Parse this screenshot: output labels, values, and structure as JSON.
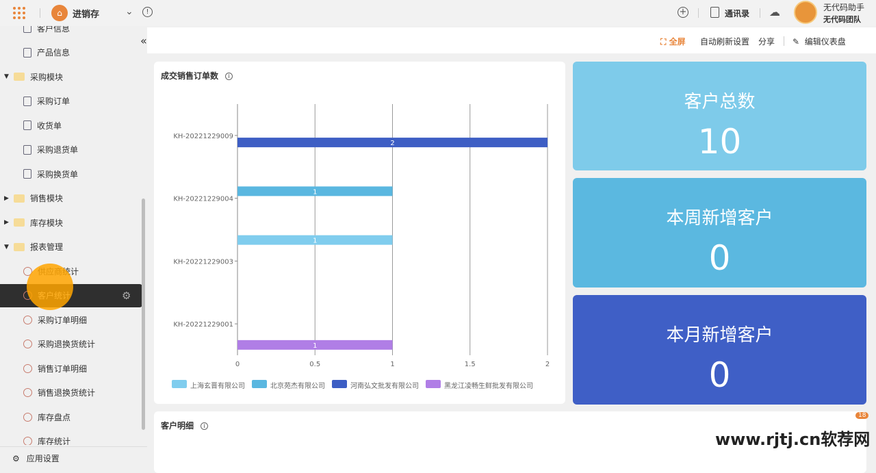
{
  "topbar": {
    "app_name": "进销存",
    "contacts": "通讯录",
    "user_name": "无代码助手",
    "team": "无代码团队"
  },
  "sidebar": {
    "items": [
      {
        "label": "客户信息",
        "type": "doc"
      },
      {
        "label": "产品信息",
        "type": "doc"
      },
      {
        "label": "采购模块",
        "type": "folder-open"
      },
      {
        "label": "采购订单",
        "type": "doc"
      },
      {
        "label": "收货单",
        "type": "doc"
      },
      {
        "label": "采购退货单",
        "type": "doc"
      },
      {
        "label": "采购换货单",
        "type": "doc"
      },
      {
        "label": "销售模块",
        "type": "folder-closed"
      },
      {
        "label": "库存模块",
        "type": "folder-closed"
      },
      {
        "label": "报表管理",
        "type": "folder-open"
      },
      {
        "label": "供应商统计",
        "type": "report"
      },
      {
        "label": "客户统计",
        "type": "report",
        "active": true
      },
      {
        "label": "采购订单明细",
        "type": "report"
      },
      {
        "label": "采购退换货统计",
        "type": "report"
      },
      {
        "label": "销售订单明细",
        "type": "report"
      },
      {
        "label": "销售退换货统计",
        "type": "report"
      },
      {
        "label": "库存盘点",
        "type": "report"
      },
      {
        "label": "库存统计",
        "type": "report"
      }
    ],
    "settings": "应用设置"
  },
  "header": {
    "fullscreen": "全屏",
    "auto_refresh": "自动刷新设置",
    "share": "分享",
    "edit": "编辑仪表盘"
  },
  "stats": [
    {
      "label": "客户总数",
      "value": "10",
      "color": "#7ecbea"
    },
    {
      "label": "本周新增客户",
      "value": "0",
      "color": "#5bb8e0"
    },
    {
      "label": "本月新增客户",
      "value": "0",
      "color": "#3f5fc6"
    }
  ],
  "detail_title": "客户明细",
  "badge": "18",
  "watermark": "www.rjtj.cn软荐网",
  "chart_data": {
    "type": "bar",
    "orientation": "horizontal",
    "title": "成交销售订单数",
    "categories": [
      "KH-20221229001",
      "KH-20221229003",
      "KH-20221229004",
      "KH-20221229009"
    ],
    "series": [
      {
        "name": "上海玄晋有限公司",
        "color": "#80cdee",
        "values": [
          0,
          1,
          0,
          0
        ]
      },
      {
        "name": "北京苑杰有限公司",
        "color": "#5ab7e0",
        "values": [
          0,
          0,
          1,
          0
        ]
      },
      {
        "name": "河南弘文批发有限公司",
        "color": "#3d5ec4",
        "values": [
          0,
          0,
          0,
          2
        ]
      },
      {
        "name": "黑龙江凌畅生鲜批发有限公司",
        "color": "#b07ee6",
        "values": [
          1,
          0,
          0,
          0
        ]
      }
    ],
    "xlim": [
      0,
      2
    ],
    "xticks": [
      "0",
      "0.5",
      "1",
      "1.5",
      "2"
    ],
    "grid": true,
    "legend": "bottom"
  }
}
